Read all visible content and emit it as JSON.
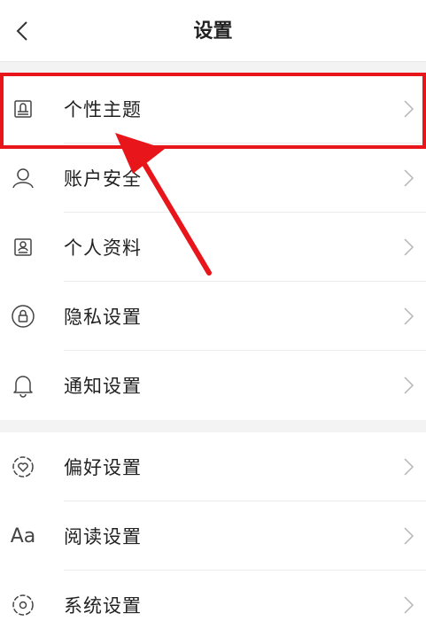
{
  "header": {
    "title": "设置"
  },
  "groups": [
    {
      "items": [
        {
          "label": "个性主题",
          "icon": "theme-brush-icon"
        },
        {
          "label": "账户安全",
          "icon": "user-icon"
        },
        {
          "label": "个人资料",
          "icon": "profile-card-icon"
        },
        {
          "label": "隐私设置",
          "icon": "lock-icon"
        },
        {
          "label": "通知设置",
          "icon": "bell-icon"
        }
      ]
    },
    {
      "items": [
        {
          "label": "偏好设置",
          "icon": "heart-gear-icon"
        },
        {
          "label": "阅读设置",
          "icon": "font-aa-icon",
          "icon_text": "Aa"
        },
        {
          "label": "系统设置",
          "icon": "system-gear-icon"
        }
      ]
    }
  ],
  "colors": {
    "highlight": "#e8151b",
    "separator": "#ececec",
    "group_gap": "#f3f3f3"
  }
}
